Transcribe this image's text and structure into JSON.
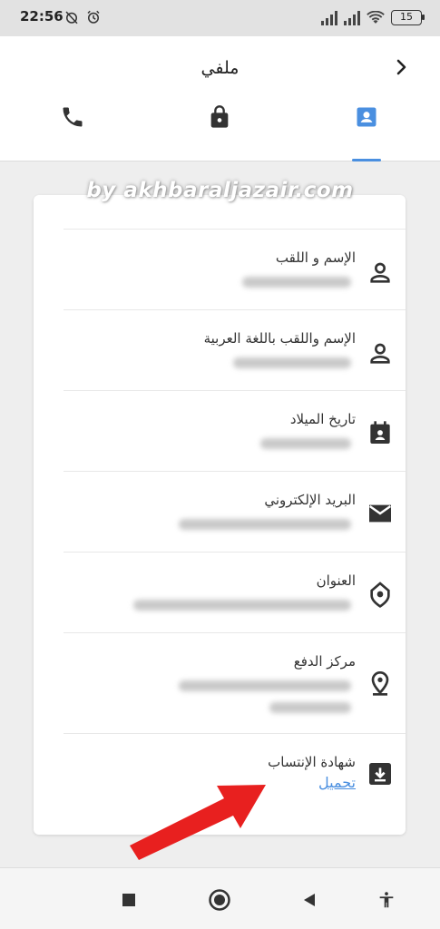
{
  "status_bar": {
    "time": "22:56",
    "battery": "15",
    "left_icons": [
      "no-alarm-icon",
      "alarm-clock-icon"
    ],
    "right_icons": [
      "signal-icon",
      "signal-icon",
      "wifi-icon",
      "battery-icon"
    ]
  },
  "header": {
    "title": "ملفي",
    "back_icon": "chevron-right-icon",
    "tabs": [
      {
        "icon": "phone-icon"
      },
      {
        "icon": "lock-icon"
      },
      {
        "icon": "contact-card-icon",
        "active": true
      }
    ]
  },
  "watermark": "by akhbaraljazair.com",
  "profile": {
    "rows": [
      {
        "label": "الإسم  و اللقب",
        "icon": "person-outline-icon"
      },
      {
        "label": "الإسم واللقب باللغة العربية",
        "icon": "person-outline-icon"
      },
      {
        "label": "تاريخ الميلاد",
        "icon": "calendar-contact-icon"
      },
      {
        "label": "البريد الإلكتروني",
        "icon": "mail-icon"
      },
      {
        "label": "العنوان",
        "icon": "home-location-icon"
      },
      {
        "label": "مركز الدفع",
        "icon": "location-pin-icon"
      },
      {
        "label": "شهادة الإنتساب",
        "icon": "download-icon",
        "link": "تحميل"
      }
    ]
  },
  "nav_bar": {
    "icons": [
      "stop-square-icon",
      "home-circle-icon",
      "back-triangle-icon",
      "accessibility-icon"
    ]
  },
  "colors": {
    "accent": "#4a8fe0",
    "arrow": "#e8201f"
  }
}
